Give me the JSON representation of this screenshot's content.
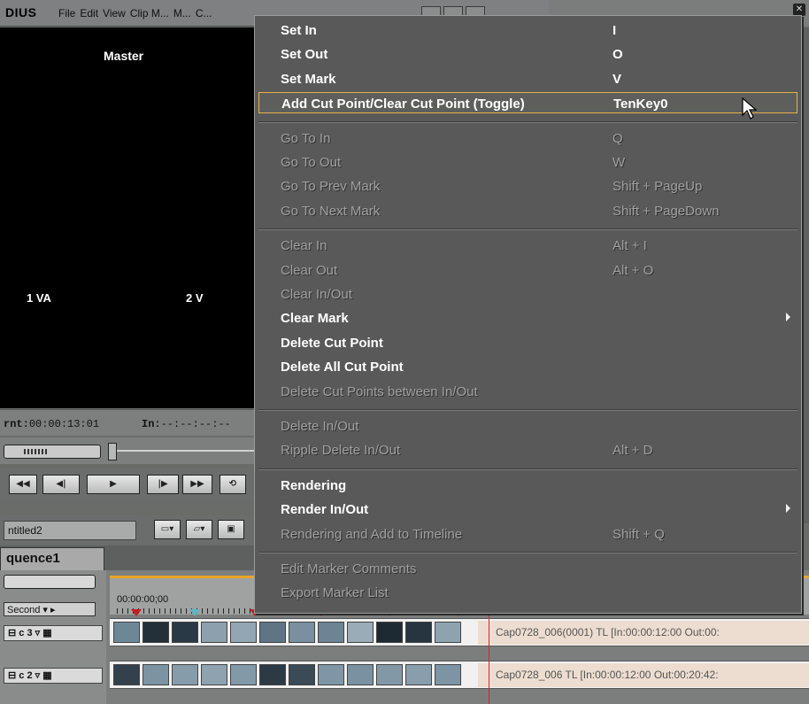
{
  "app": {
    "name": "DIUS",
    "menu": [
      "File",
      "Edit",
      "View",
      "Clip M...",
      "M...",
      "C..."
    ]
  },
  "monitor": {
    "title": "Master",
    "track_va": "1 VA",
    "track_v": "2 V",
    "current_label": "rnt:",
    "current_tc": "00:00:13:01",
    "in_label": "In:",
    "in_tc": "--:--:--:--"
  },
  "file": {
    "name": "ntitled2"
  },
  "sequence": {
    "tab": "quence1"
  },
  "timeline": {
    "unit": "Second",
    "ruler_tc": "00:00:00;00",
    "tracks": [
      {
        "label": "c 3",
        "clip": "Cap0728_006(0001)  TL [In:00:00:12:00 Out:00:"
      },
      {
        "label": "c 2",
        "clip": "Cap0728_006  TL [In:00:00:12:00 Out:00:20:42:"
      }
    ]
  },
  "context_menu": {
    "items": [
      {
        "label": "Set In",
        "shortcut": "I",
        "enabled": true
      },
      {
        "label": "Set Out",
        "shortcut": "O",
        "enabled": true
      },
      {
        "label": "Set Mark",
        "shortcut": "V",
        "enabled": true
      },
      {
        "label": "Add Cut Point/Clear Cut Point (Toggle)",
        "shortcut": "TenKey0",
        "enabled": true,
        "selected": true
      },
      {
        "separator": true
      },
      {
        "label": "Go To In",
        "shortcut": "Q",
        "enabled": false
      },
      {
        "label": "Go To Out",
        "shortcut": "W",
        "enabled": false
      },
      {
        "label": "Go To Prev Mark",
        "shortcut": "Shift + PageUp",
        "enabled": false
      },
      {
        "label": "Go To Next Mark",
        "shortcut": "Shift + PageDown",
        "enabled": false
      },
      {
        "separator": true
      },
      {
        "label": "Clear In",
        "shortcut": "Alt + I",
        "enabled": false
      },
      {
        "label": "Clear Out",
        "shortcut": "Alt + O",
        "enabled": false
      },
      {
        "label": "Clear In/Out",
        "shortcut": "",
        "enabled": false
      },
      {
        "label": "Clear Mark",
        "shortcut": "",
        "enabled": true,
        "submenu": true
      },
      {
        "label": "Delete Cut Point",
        "shortcut": "",
        "enabled": true
      },
      {
        "label": "Delete All Cut Point",
        "shortcut": "",
        "enabled": true
      },
      {
        "label": "Delete Cut Points between In/Out",
        "shortcut": "",
        "enabled": false
      },
      {
        "separator": true
      },
      {
        "label": "Delete In/Out",
        "shortcut": "",
        "enabled": false
      },
      {
        "label": "Ripple Delete In/Out",
        "shortcut": "Alt + D",
        "enabled": false
      },
      {
        "separator": true
      },
      {
        "label": "Rendering",
        "shortcut": "",
        "enabled": true
      },
      {
        "label": "Render In/Out",
        "shortcut": "",
        "enabled": true,
        "submenu": true
      },
      {
        "label": "Rendering and Add to Timeline",
        "shortcut": "Shift + Q",
        "enabled": false
      },
      {
        "separator": true
      },
      {
        "label": "Edit Marker Comments",
        "shortcut": "",
        "enabled": false
      },
      {
        "label": "Export Marker List",
        "shortcut": "",
        "enabled": false
      }
    ]
  },
  "colors": {
    "menu_bg": "#585958",
    "selected_border": "#e8b04a",
    "playhead": "#dd2222",
    "ruler_accent": "#e8a528"
  }
}
